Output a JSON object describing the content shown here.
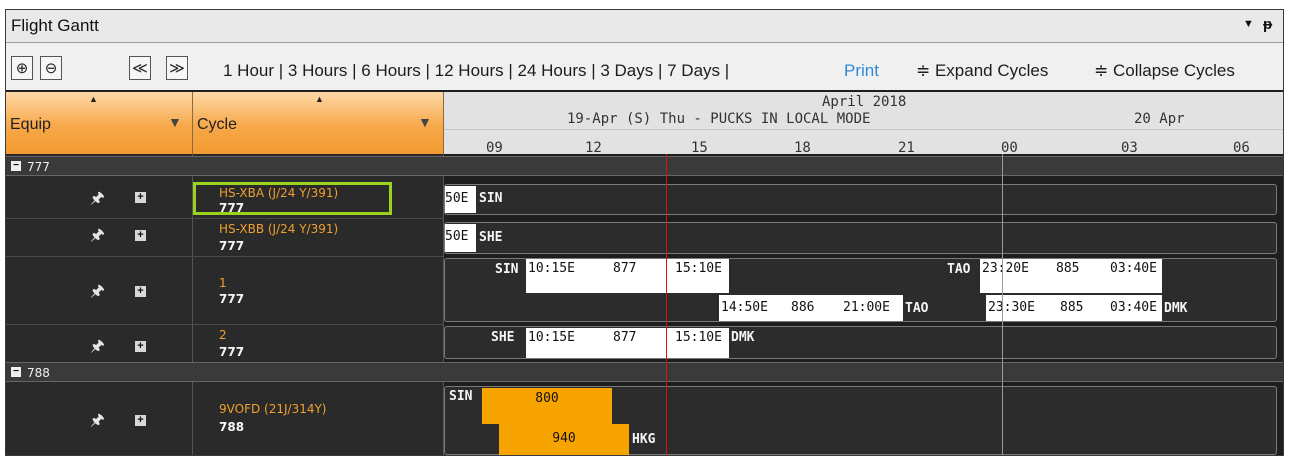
{
  "window": {
    "title": "Flight Gantt",
    "dropdown_glyph": "▼",
    "pin_glyph": "ᵽ"
  },
  "toolbar": {
    "zoom_in_icon": "zoom-in-icon",
    "zoom_out_icon": "zoom-out-icon",
    "prev_icon": "double-left-icon",
    "next_icon": "double-right-icon",
    "zoom_in_glyph": "⊕",
    "zoom_out_glyph": "⊖",
    "prev_glyph": "≪",
    "next_glyph": "≫",
    "ranges_text": "1 Hour | 3 Hours | 6 Hours | 12 Hours | 24 Hours | 3 Days | 7 Days |",
    "print_label": "Print",
    "expand_label": "≑ Expand Cycles",
    "collapse_label": "≑ Collapse Cycles"
  },
  "columns": {
    "equip_label": "Equip",
    "cycle_label": "Cycle",
    "sort_glyph": "▲",
    "filter_glyph": "▼"
  },
  "timeline": {
    "month": "April 2018",
    "day1": "19-Apr (S) Thu - PUCKS IN LOCAL MODE",
    "day2": "20 Apr",
    "ticks": [
      "09",
      "12",
      "15",
      "18",
      "21",
      "00",
      "03",
      "06"
    ]
  },
  "groups": [
    {
      "label": "777",
      "toggle": "−"
    },
    {
      "label": "788",
      "toggle": "−"
    }
  ],
  "rows": [
    {
      "name": "HS-XBA (J/24 Y/391)",
      "equip": "777"
    },
    {
      "name": "HS-XBB (J/24 Y/391)",
      "equip": "777"
    },
    {
      "name": "1",
      "equip": "777"
    },
    {
      "name": "2",
      "equip": "777"
    },
    {
      "name": "9VOFD (21J/314Y)",
      "equip": "788"
    }
  ],
  "row_icons": {
    "pin": "🖈",
    "plus": "+"
  },
  "gantt": {
    "r1": {
      "tag": "50E",
      "label": "SIN"
    },
    "r2": {
      "tag": "50E",
      "label": "SHE"
    },
    "r3": {
      "a_from": "SIN",
      "a_dep": "10:15E",
      "a_flt": "877",
      "a_arr": "15:10E",
      "b_dep": "14:50E",
      "b_flt": "886",
      "b_arr": "21:00E",
      "b_to": "TAO",
      "c_from": "TAO",
      "c_dep": "23:20E",
      "c_flt": "885",
      "c_arr": "03:40E",
      "d_dep": "23:30E",
      "d_flt": "885",
      "d_arr": "03:40E",
      "d_to": "DMK"
    },
    "r4": {
      "from": "SHE",
      "dep": "10:15E",
      "flt": "877",
      "arr": "15:10E",
      "to": "DMK"
    },
    "r5": {
      "from": "SIN",
      "flt1": "800",
      "flt2": "940",
      "to": "HKG"
    }
  },
  "colors": {
    "accent": "#f7a400",
    "highlight": "#9bd21e",
    "now_line": "#e01010",
    "print_link": "#2d8ad8"
  }
}
